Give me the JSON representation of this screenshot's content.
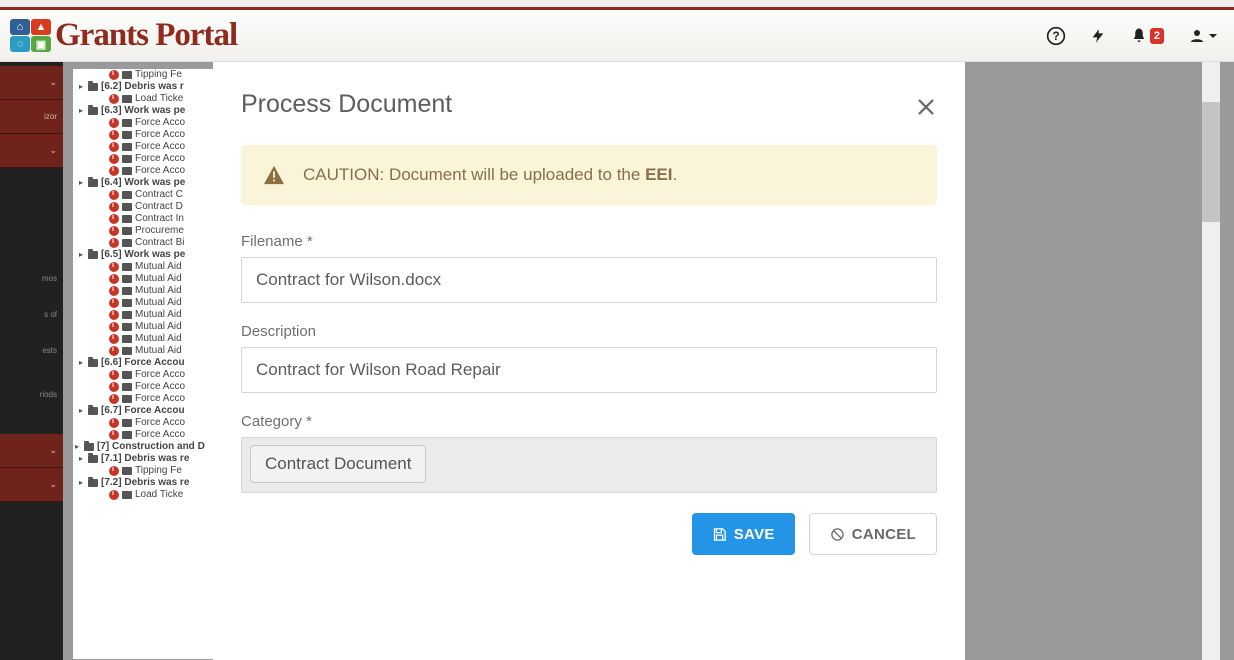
{
  "header": {
    "brand": "Grants Portal",
    "notification_count": "2"
  },
  "sidebar_truncated": [
    "",
    "izor",
    "",
    "",
    "mos",
    "s of",
    "",
    "ests",
    "",
    "riods",
    "",
    "",
    ""
  ],
  "tree": [
    {
      "type": "leaf",
      "lvl": 2,
      "label": "Tipping Fe"
    },
    {
      "type": "parent",
      "lvl": 1,
      "label": "[6.2] Debris was r"
    },
    {
      "type": "leaf",
      "lvl": 2,
      "label": "Load Ticke"
    },
    {
      "type": "parent",
      "lvl": 1,
      "label": "[6.3] Work was pe"
    },
    {
      "type": "leaf",
      "lvl": 2,
      "label": "Force Acco"
    },
    {
      "type": "leaf",
      "lvl": 2,
      "label": "Force Acco"
    },
    {
      "type": "leaf",
      "lvl": 2,
      "label": "Force Acco"
    },
    {
      "type": "leaf",
      "lvl": 2,
      "label": "Force Acco"
    },
    {
      "type": "leaf",
      "lvl": 2,
      "label": "Force Acco"
    },
    {
      "type": "parent",
      "lvl": 1,
      "label": "[6.4] Work was pe"
    },
    {
      "type": "leaf",
      "lvl": 2,
      "label": "Contract C"
    },
    {
      "type": "leaf",
      "lvl": 2,
      "label": "Contract D"
    },
    {
      "type": "leaf",
      "lvl": 2,
      "label": "Contract In"
    },
    {
      "type": "leaf",
      "lvl": 2,
      "label": "Procureme"
    },
    {
      "type": "leaf",
      "lvl": 2,
      "label": "Contract Bi"
    },
    {
      "type": "parent",
      "lvl": 1,
      "label": "[6.5] Work was pe"
    },
    {
      "type": "leaf",
      "lvl": 2,
      "label": "Mutual Aid"
    },
    {
      "type": "leaf",
      "lvl": 2,
      "label": "Mutual Aid"
    },
    {
      "type": "leaf",
      "lvl": 2,
      "label": "Mutual Aid"
    },
    {
      "type": "leaf",
      "lvl": 2,
      "label": "Mutual Aid"
    },
    {
      "type": "leaf",
      "lvl": 2,
      "label": "Mutual Aid"
    },
    {
      "type": "leaf",
      "lvl": 2,
      "label": "Mutual Aid"
    },
    {
      "type": "leaf",
      "lvl": 2,
      "label": "Mutual Aid"
    },
    {
      "type": "leaf",
      "lvl": 2,
      "label": "Mutual Aid"
    },
    {
      "type": "parent",
      "lvl": 1,
      "label": "[6.6] Force Accou"
    },
    {
      "type": "leaf",
      "lvl": 2,
      "label": "Force Acco"
    },
    {
      "type": "leaf",
      "lvl": 2,
      "label": "Force Acco"
    },
    {
      "type": "leaf",
      "lvl": 2,
      "label": "Force Acco"
    },
    {
      "type": "parent",
      "lvl": 1,
      "label": "[6.7] Force Accou"
    },
    {
      "type": "leaf",
      "lvl": 2,
      "label": "Force Acco"
    },
    {
      "type": "leaf",
      "lvl": 2,
      "label": "Force Acco"
    },
    {
      "type": "parent",
      "lvl": 0,
      "label": "[7] Construction and D"
    },
    {
      "type": "parent",
      "lvl": 1,
      "label": "[7.1] Debris was re"
    },
    {
      "type": "leaf",
      "lvl": 2,
      "label": "Tipping Fe"
    },
    {
      "type": "parent",
      "lvl": 1,
      "label": "[7.2] Debris was re"
    },
    {
      "type": "leaf",
      "lvl": 2,
      "label": "Load Ticke"
    }
  ],
  "modal": {
    "title": "Process Document",
    "caution_prefix": "CAUTION: Document will be uploaded to the ",
    "caution_bold": "EEI",
    "caution_suffix": ".",
    "filename_label": "Filename  *",
    "filename_value": "Contract for Wilson.docx",
    "description_label": "Description",
    "description_value": "Contract for Wilson Road Repair",
    "category_label": "Category  *",
    "category_value": "Contract Document",
    "save_label": "SAVE",
    "cancel_label": "CANCEL"
  }
}
